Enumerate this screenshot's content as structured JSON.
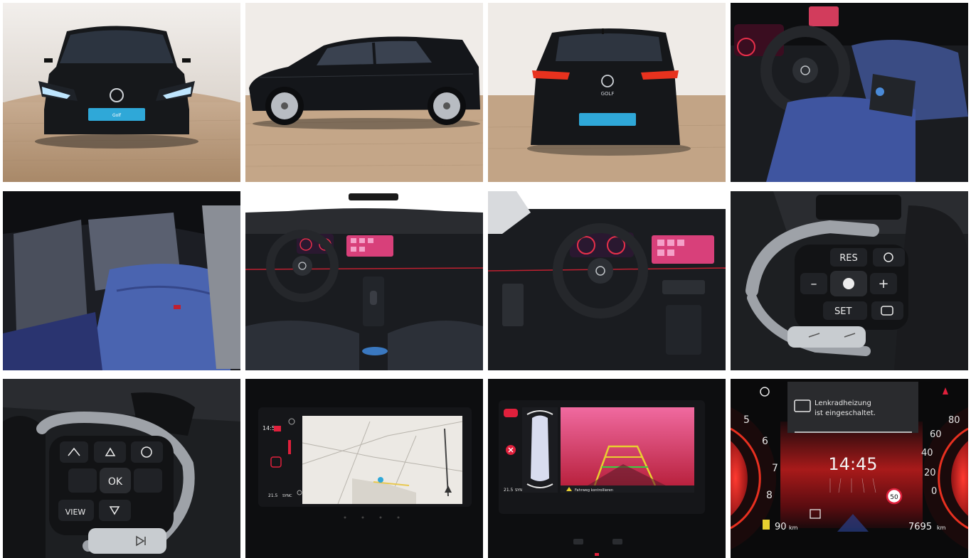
{
  "gallery": {
    "tiles": [
      {
        "name": "exterior-front",
        "plate_text": "Golf"
      },
      {
        "name": "exterior-side"
      },
      {
        "name": "exterior-rear",
        "badge": "GOLF"
      },
      {
        "name": "interior-cockpit-driver"
      },
      {
        "name": "interior-rear-seats"
      },
      {
        "name": "interior-dashboard-center"
      },
      {
        "name": "interior-dashboard-wide"
      },
      {
        "name": "steering-wheel-right-buttons",
        "res": "RES",
        "set": "SET",
        "minus": "–",
        "plus": "+"
      },
      {
        "name": "steering-wheel-left-buttons",
        "ok": "OK",
        "view": "VIEW"
      },
      {
        "name": "navigation-screen",
        "time": "14:51",
        "temp": "21.5",
        "sync": "SYNC"
      },
      {
        "name": "park-assist-screen",
        "temp": "21.5",
        "sync": "SYNC",
        "warning": "Fahrweg kontrollieren"
      },
      {
        "name": "digital-cockpit",
        "message_line1": "Lenkradheizung",
        "message_line2": "ist eingeschaltet.",
        "clock": "14:45",
        "range": "90",
        "range_unit": "km",
        "odometer": "7695",
        "odo_unit": "km",
        "speed_limit": "50",
        "rpm_5": "5",
        "rpm_6": "6",
        "rpm_7": "7",
        "rpm_8": "8",
        "spd_80": "80",
        "spd_60": "60",
        "spd_40": "40",
        "spd_20": "20",
        "spd_0": "0"
      }
    ]
  },
  "colors": {
    "showroom_wall": "#e8e4e0",
    "showroom_floor": "#b89a7e",
    "car_black": "#141618",
    "seat_blue": "#4a5f9c",
    "vw_blue": "#2fa8d8",
    "screen_red": "#e0203c",
    "screen_pink": "#e85c9c"
  }
}
